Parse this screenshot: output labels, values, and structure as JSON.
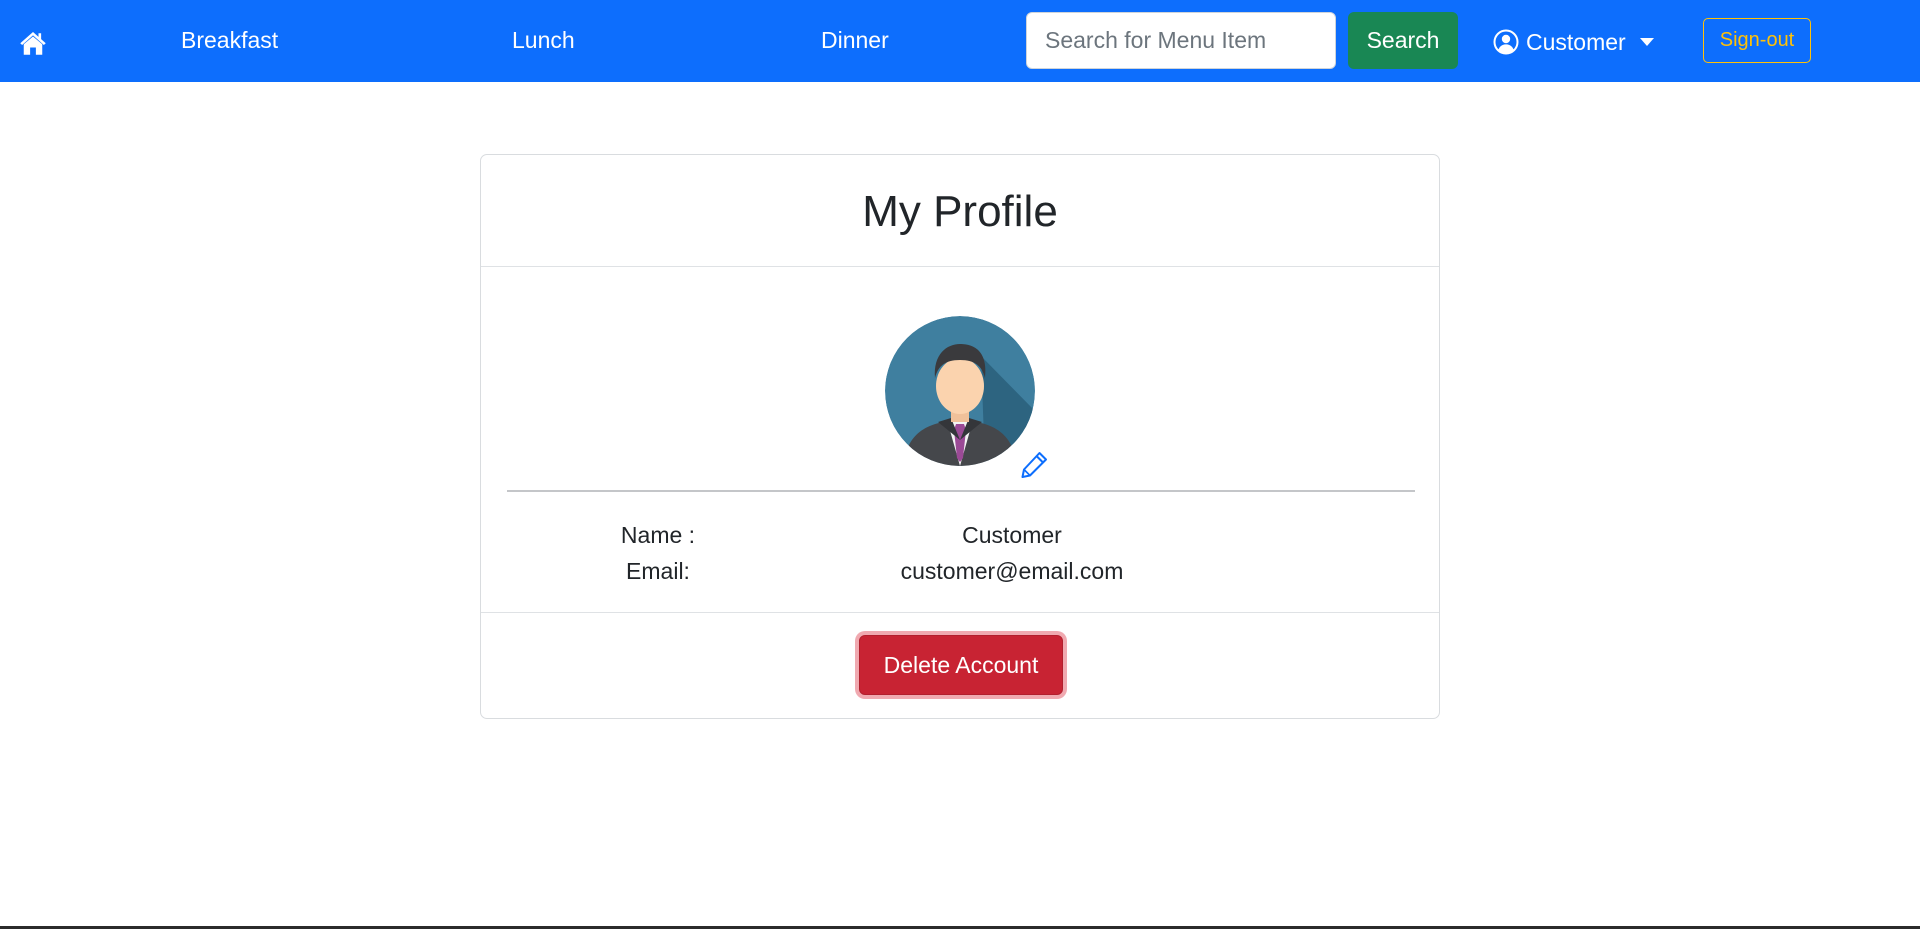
{
  "navbar": {
    "home_icon": "home-icon",
    "links": {
      "breakfast": "Breakfast",
      "lunch": "Lunch",
      "dinner": "Dinner"
    },
    "search": {
      "placeholder": "Search for Menu Item",
      "value": "",
      "button_label": "Search"
    },
    "user": {
      "icon": "user-circle-icon",
      "label": "Customer"
    },
    "signout_label": "Sign-out"
  },
  "profile": {
    "title": "My Profile",
    "avatar_icon": "businessman-avatar",
    "edit_icon": "pencil-icon",
    "fields": {
      "name_label": "Name :",
      "name_value": "Customer",
      "email_label": "Email:",
      "email_value": "customer@email.com"
    },
    "delete_label": "Delete Account"
  },
  "colors": {
    "navbar": "#0d6efd",
    "search_button": "#198754",
    "signout": "#ffc107",
    "delete_button": "#c82333",
    "edit_icon": "#0d6efd"
  }
}
